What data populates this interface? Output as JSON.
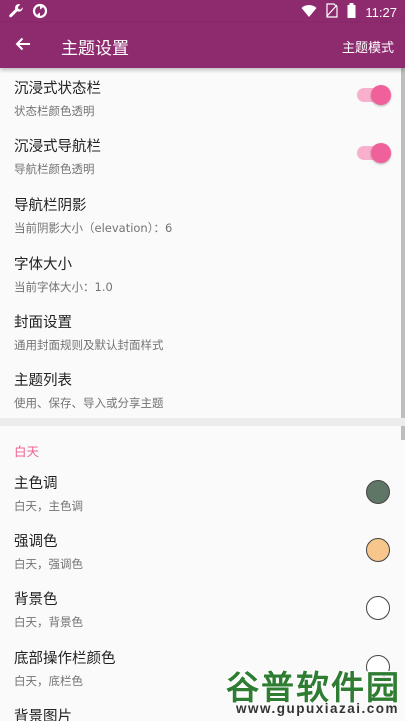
{
  "status_bar": {
    "time": "11:27",
    "left_icons": [
      "wrench-icon",
      "sync-icon"
    ],
    "right_icons": [
      "wifi-icon",
      "no-sim-icon",
      "battery-icon"
    ]
  },
  "app_bar": {
    "title": "主题设置",
    "action": "主题模式"
  },
  "settings": [
    {
      "title": "沉浸式状态栏",
      "subtitle": "状态栏颜色透明",
      "toggle": true
    },
    {
      "title": "沉浸式导航栏",
      "subtitle": "导航栏颜色透明",
      "toggle": true
    },
    {
      "title": "导航栏阴影",
      "subtitle": "当前阴影大小（elevation）：6"
    },
    {
      "title": "字体大小",
      "subtitle": "当前字体大小：1.0"
    },
    {
      "title": "封面设置",
      "subtitle": "通用封面规则及默认封面样式"
    },
    {
      "title": "主题列表",
      "subtitle": "使用、保存、导入或分享主题"
    }
  ],
  "day_section": {
    "header": "白天",
    "items": [
      {
        "title": "主色调",
        "subtitle": "白天，主色调",
        "color": "#5f7566"
      },
      {
        "title": "强调色",
        "subtitle": "白天，强调色",
        "color": "#f6c68c"
      },
      {
        "title": "背景色",
        "subtitle": "白天，背景色",
        "color": "#ffffff"
      },
      {
        "title": "底部操作栏颜色",
        "subtitle": "白天，底栏色",
        "color": "#ffffff"
      },
      {
        "title": "背景图片"
      }
    ]
  },
  "colors": {
    "app_bar": "#8e2a6e",
    "accent": "#f06292"
  },
  "watermark": {
    "brand": "谷普软件园",
    "url": "www.gupuxiazai.com"
  }
}
